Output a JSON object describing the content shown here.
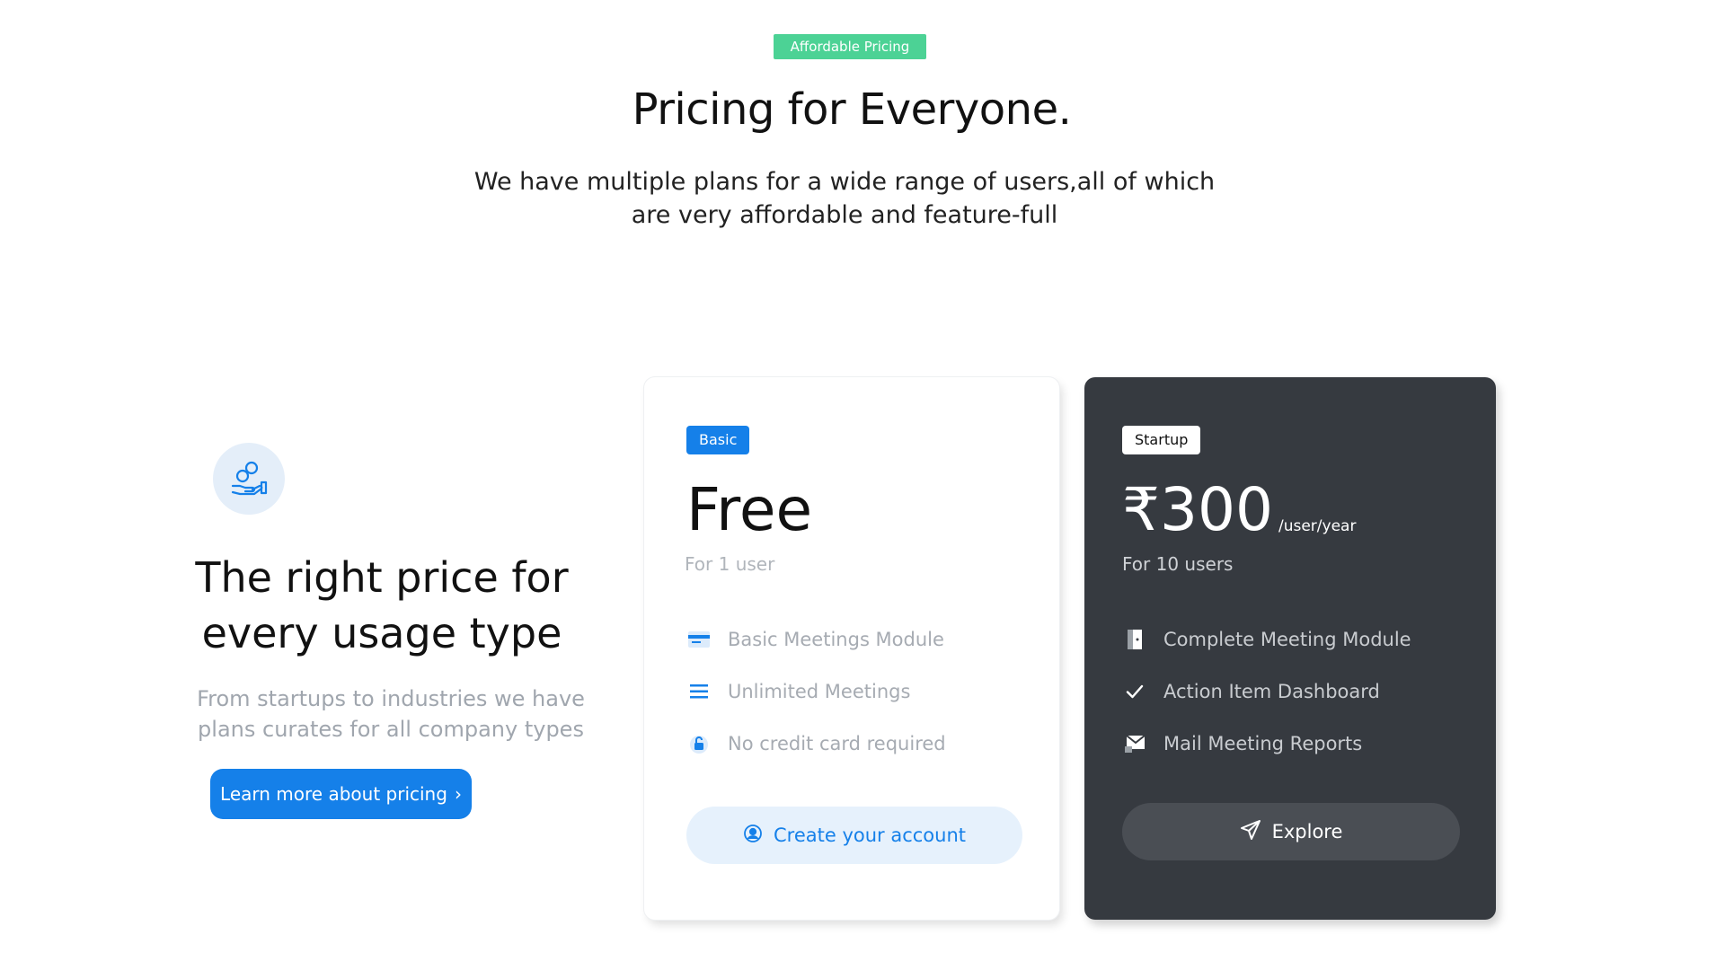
{
  "header": {
    "badge": "Affordable Pricing",
    "title": "Pricing for Everyone.",
    "subtitle": "We have multiple plans for a wide range of users,all of which are very affordable and feature-full"
  },
  "promo": {
    "icon": "coins-hand-icon",
    "title": "The right price for every usage type",
    "subtitle": "From startups to industries we have plans curates for all company types",
    "button_label": "Learn more about pricing",
    "button_chevron": "›"
  },
  "plans": [
    {
      "tag": "Basic",
      "price": "Free",
      "for_users": "For 1 user",
      "features": [
        {
          "icon": "card-icon",
          "label": "Basic Meetings  Module"
        },
        {
          "icon": "list-icon",
          "label": "Unlimited Meetings"
        },
        {
          "icon": "lock-icon",
          "label": "No credit card required"
        }
      ],
      "button_label": "Create your account",
      "button_icon": "user-circle-icon"
    },
    {
      "tag": "Startup",
      "price": "₹300",
      "price_unit": "/user/year",
      "for_users": "For 10 users",
      "features": [
        {
          "icon": "door-icon",
          "label": "Complete Meeting Module"
        },
        {
          "icon": "check-icon",
          "label": "Action Item Dashboard"
        },
        {
          "icon": "mail-icon",
          "label": "Mail Meeting Reports"
        }
      ],
      "button_label": "Explore",
      "button_icon": "send-icon"
    }
  ],
  "colors": {
    "accent": "#1580e9",
    "badge_green": "#4cd295",
    "dark_card": "#363a40",
    "muted_text": "#a0a6ae"
  }
}
